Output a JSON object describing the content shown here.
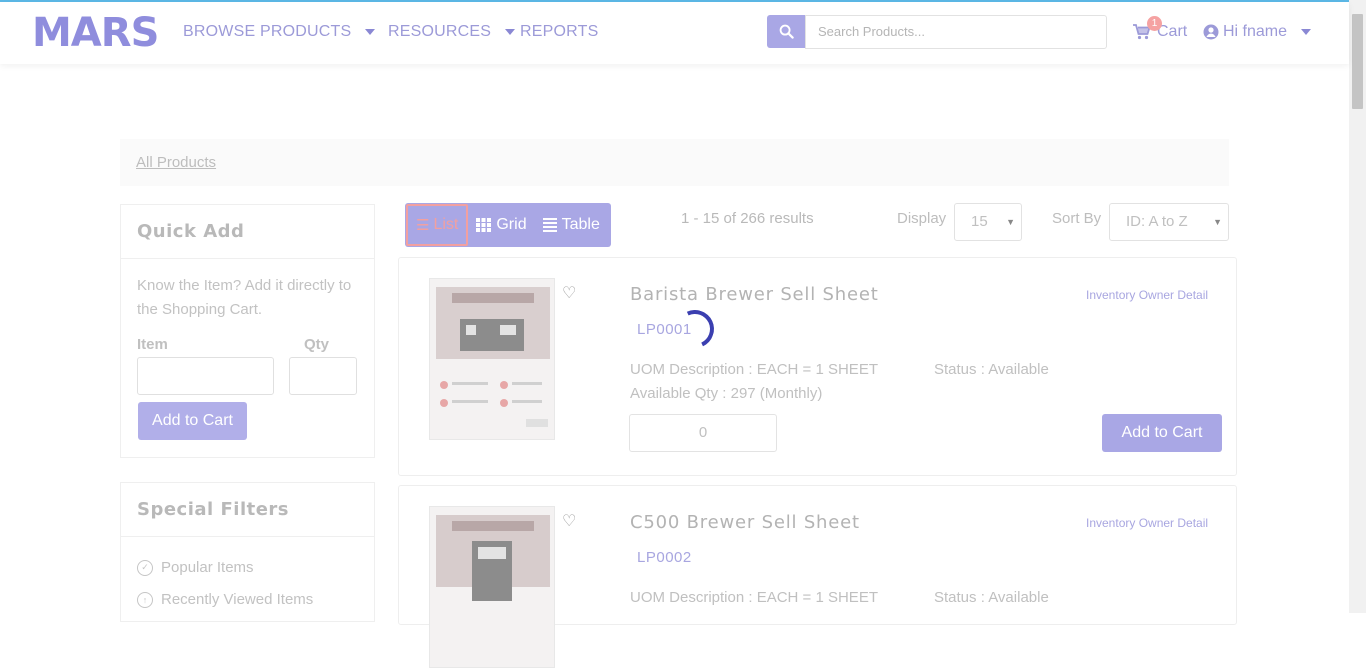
{
  "brand": {
    "logo": "MARS"
  },
  "nav": {
    "browse": "BROWSE PRODUCTS",
    "resources": "RESOURCES",
    "reports": "REPORTS"
  },
  "search": {
    "placeholder": "Search Products..."
  },
  "cart": {
    "label": "Cart",
    "count": "1"
  },
  "user": {
    "greeting": "Hi fname"
  },
  "breadcrumb": {
    "all": "All Products"
  },
  "quick_add": {
    "title": "Quick Add",
    "description": "Know the Item? Add it directly to the Shopping Cart.",
    "item_label": "Item",
    "qty_label": "Qty",
    "button": "Add to Cart"
  },
  "special_filters": {
    "title": "Special Filters",
    "items": [
      {
        "label": "Popular Items",
        "icon": "check-circle-icon"
      },
      {
        "label": "Recently Viewed Items",
        "icon": "arrow-up-circle-icon"
      }
    ]
  },
  "view_tabs": {
    "list": "List",
    "grid": "Grid",
    "table": "Table",
    "active": "list"
  },
  "results": {
    "summary": "1 - 15 of 266 results"
  },
  "display": {
    "label": "Display",
    "value": "15"
  },
  "sort": {
    "label": "Sort By",
    "value": "ID: A to Z"
  },
  "products": [
    {
      "title": "Barista Brewer Sell Sheet",
      "code": "LP0001",
      "inventory_link": "Inventory Owner Detail",
      "uom": "UOM Description : EACH = 1 SHEET",
      "status": "Status : Available",
      "available": "Available Qty : 297 (Monthly)",
      "qty": "0",
      "button": "Add to Cart"
    },
    {
      "title": "C500 Brewer Sell Sheet",
      "code": "LP0002",
      "inventory_link": "Inventory Owner Detail",
      "uom": "UOM Description : EACH = 1 SHEET",
      "status": "Status : Available"
    }
  ],
  "colors": {
    "accent": "#a9a7e5",
    "brand": "#8f8ddd",
    "active_tab": "#f2a0a0",
    "spinner": "#3b3fb0"
  }
}
